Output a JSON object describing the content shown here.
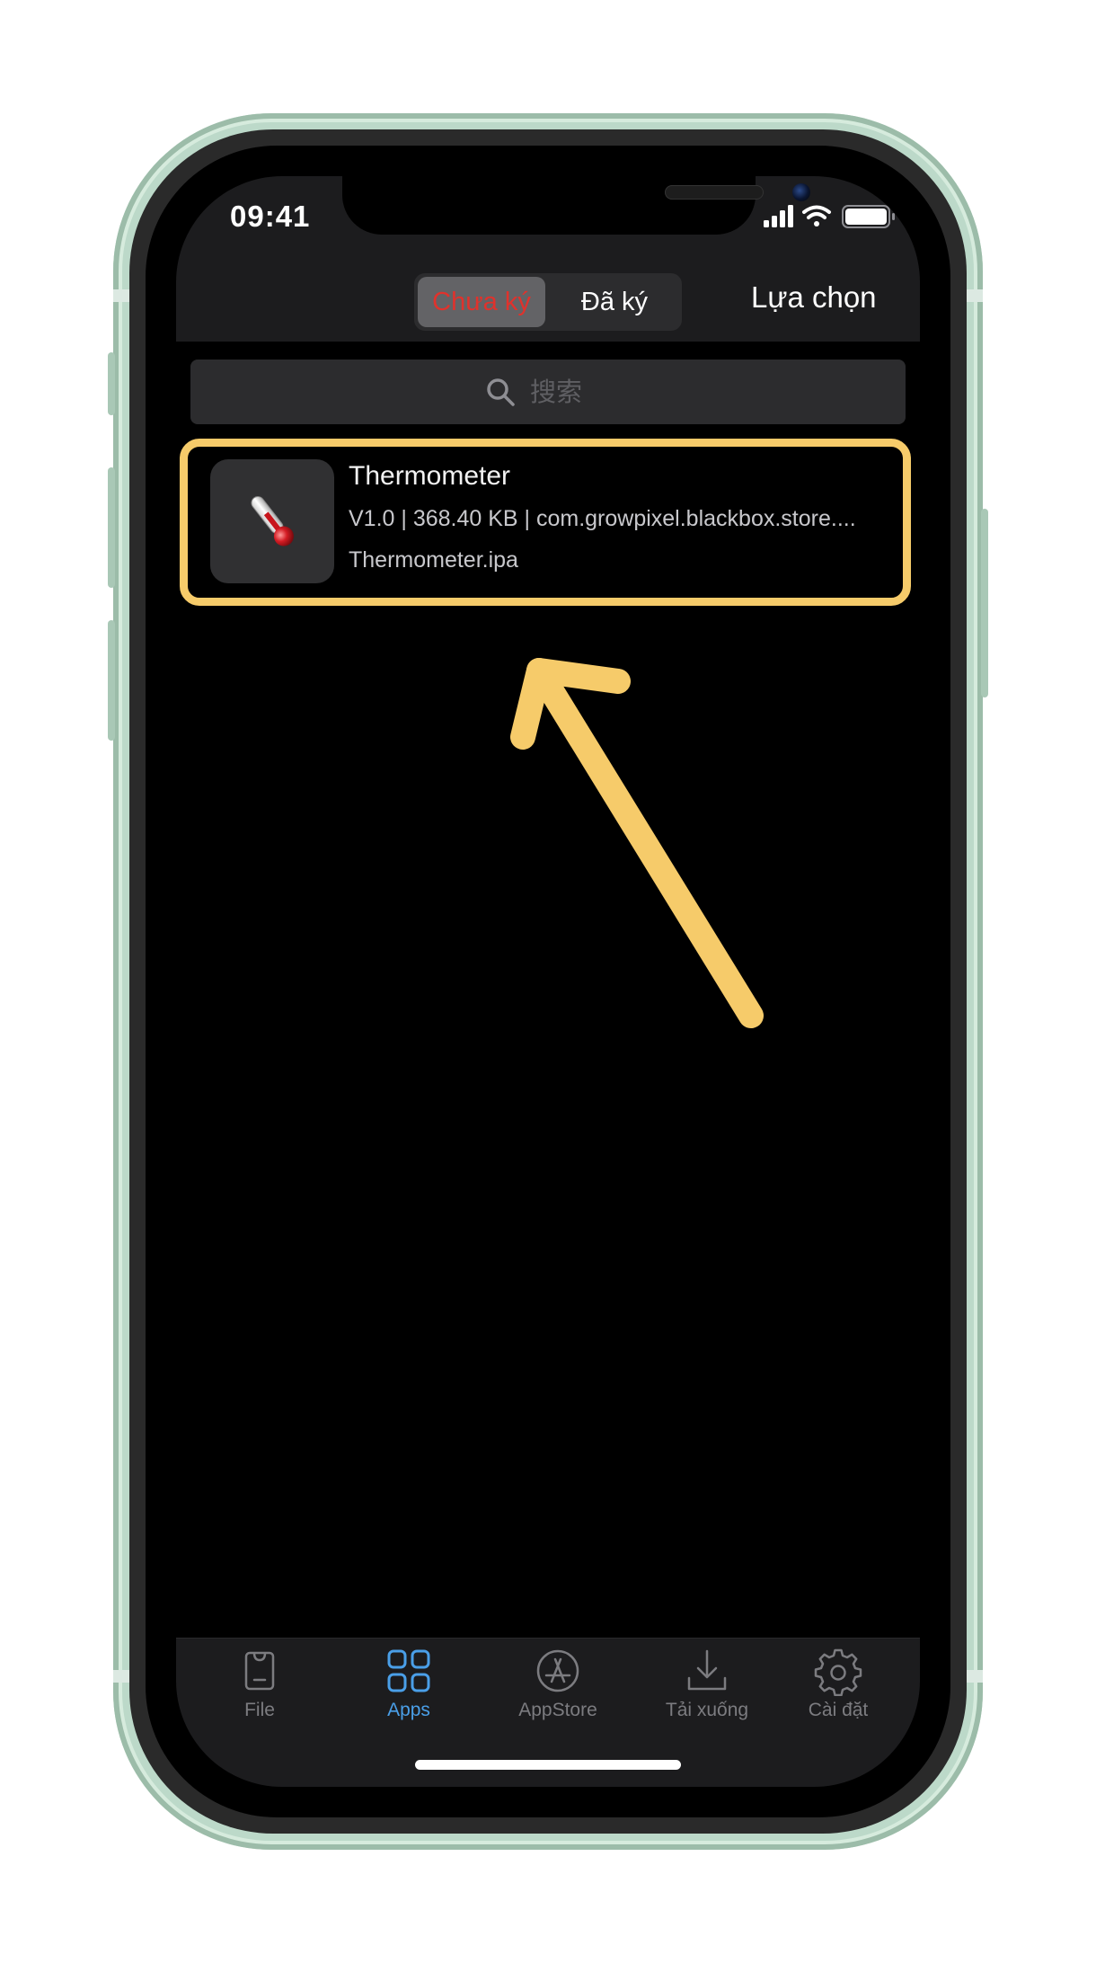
{
  "status_bar": {
    "time": "09:41"
  },
  "nav": {
    "segments": [
      "Chưa ký",
      "Đã ký"
    ],
    "selected_segment": "Chưa ký",
    "right_button": "Lựa chọn"
  },
  "search": {
    "placeholder": "搜索"
  },
  "apps": [
    {
      "name": "Thermometer",
      "meta": "V1.0 | 368.40 KB | com.growpixel.blackbox.store....",
      "file": "Thermometer.ipa",
      "icon": "thermometer-icon"
    }
  ],
  "tabs": [
    {
      "label": "File",
      "icon": "file-bag-icon",
      "active": false
    },
    {
      "label": "Apps",
      "icon": "apps-grid-icon",
      "active": true
    },
    {
      "label": "AppStore",
      "icon": "appstore-icon",
      "active": false
    },
    {
      "label": "Tải xuống",
      "icon": "download-icon",
      "active": false
    },
    {
      "label": "Cài đặt",
      "icon": "gear-icon",
      "active": false
    }
  ],
  "colors": {
    "highlight": "#f6cb6a",
    "tab_active": "#4a9fe8",
    "segment_selected_text": "#e0322c",
    "phone_frame": "#bcd9c9"
  }
}
